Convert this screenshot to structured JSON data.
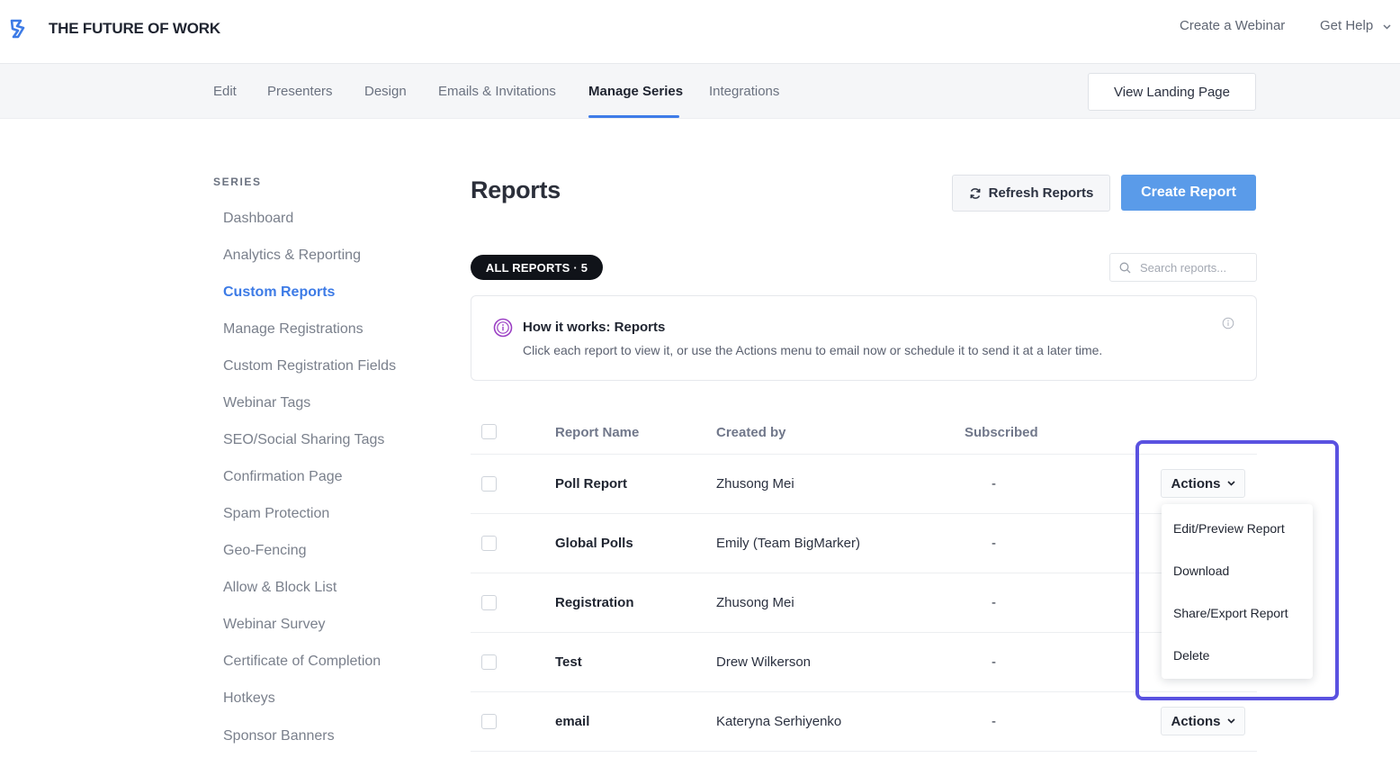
{
  "header": {
    "brand": "THE FUTURE OF WORK",
    "create_webinar": "Create a Webinar",
    "get_help": "Get Help"
  },
  "nav": {
    "tabs": [
      {
        "label": "Edit"
      },
      {
        "label": "Presenters"
      },
      {
        "label": "Design"
      },
      {
        "label": "Emails & Invitations"
      },
      {
        "label": "Manage Series",
        "active": true
      },
      {
        "label": "Integrations"
      }
    ],
    "view_landing_page": "View Landing Page"
  },
  "sidebar": {
    "section_label": "SERIES",
    "items": [
      {
        "label": "Dashboard"
      },
      {
        "label": "Analytics & Reporting"
      },
      {
        "label": "Custom Reports",
        "active": true
      },
      {
        "label": "Manage Registrations"
      },
      {
        "label": "Custom Registration Fields"
      },
      {
        "label": "Webinar Tags"
      },
      {
        "label": "SEO/Social Sharing Tags"
      },
      {
        "label": "Confirmation Page"
      },
      {
        "label": "Spam Protection"
      },
      {
        "label": "Geo-Fencing"
      },
      {
        "label": "Allow & Block List"
      },
      {
        "label": "Webinar Survey"
      },
      {
        "label": "Certificate of Completion"
      },
      {
        "label": "Hotkeys"
      },
      {
        "label": "Sponsor Banners"
      }
    ]
  },
  "main": {
    "title": "Reports",
    "refresh_label": "Refresh Reports",
    "create_label": "Create Report",
    "filter_pill": "ALL REPORTS · 5",
    "search_placeholder": "Search reports...",
    "info": {
      "title": "How it works: Reports",
      "text": "Click each report to view it, or use the Actions menu to email now or schedule it to send it at a later time."
    },
    "table": {
      "columns": [
        "Report Name",
        "Created by",
        "Subscribed"
      ],
      "rows": [
        {
          "name": "Poll Report",
          "created_by": "Zhusong Mei",
          "subscribed": "-"
        },
        {
          "name": "Global Polls",
          "created_by": "Emily (Team BigMarker)",
          "subscribed": "-"
        },
        {
          "name": "Registration",
          "created_by": "Zhusong Mei",
          "subscribed": "-"
        },
        {
          "name": "Test",
          "created_by": "Drew Wilkerson",
          "subscribed": "-"
        },
        {
          "name": "email",
          "created_by": "Kateryna Serhiyenko",
          "subscribed": "-"
        }
      ],
      "actions_label": "Actions"
    },
    "actions_menu": {
      "items": [
        "Edit/Preview Report",
        "Download",
        "Share/Export Report",
        "Delete"
      ]
    }
  },
  "colors": {
    "accent": "#3d7be6",
    "primary_button": "#5a9be9",
    "highlight": "#5a52e0",
    "pill_bg": "#101319"
  },
  "icons": {
    "logo": "brand-logo-icon",
    "refresh": "refresh-icon",
    "search": "search-icon",
    "info": "info-circle-icon"
  }
}
